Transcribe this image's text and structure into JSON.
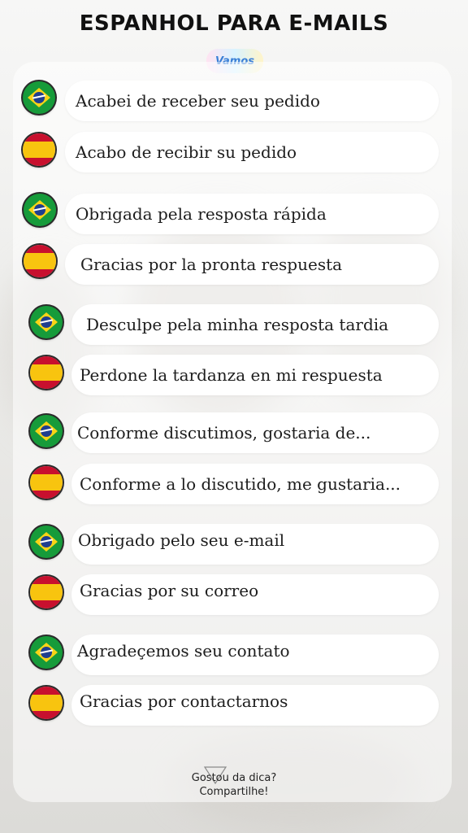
{
  "header": {
    "title": "ESPANHOL PARA E-MAILS",
    "logo_text": "Vamos"
  },
  "phrases": [
    {
      "lang": "pt",
      "flag": "brazil-flag-icon",
      "text": "Acabei de receber seu pedido"
    },
    {
      "lang": "es",
      "flag": "spain-flag-icon",
      "text": "Acabo de recibir su pedido"
    },
    {
      "lang": "pt",
      "flag": "brazil-flag-icon",
      "text": "Obrigada pela resposta rápida"
    },
    {
      "lang": "es",
      "flag": "spain-flag-icon",
      "text": "Gracias por la pronta respuesta"
    },
    {
      "lang": "pt",
      "flag": "brazil-flag-icon",
      "text": "Desculpe pela minha resposta tardia"
    },
    {
      "lang": "es",
      "flag": "spain-flag-icon",
      "text": "Perdone la tardanza en mi respuesta"
    },
    {
      "lang": "pt",
      "flag": "brazil-flag-icon",
      "text": "Conforme discutimos, gostaria de..."
    },
    {
      "lang": "es",
      "flag": "spain-flag-icon",
      "text": "Conforme a lo discutido, me gustaria..."
    },
    {
      "lang": "pt",
      "flag": "brazil-flag-icon",
      "text": "Obrigado pelo seu e-mail"
    },
    {
      "lang": "es",
      "flag": "spain-flag-icon",
      "text": "Gracias por su correo"
    },
    {
      "lang": "pt",
      "flag": "brazil-flag-icon",
      "text": "Agradeçemos seu contato"
    },
    {
      "lang": "es",
      "flag": "spain-flag-icon",
      "text": "Gracias por contactarnos"
    }
  ],
  "footer": {
    "line1": "Gostou da dica?",
    "line2": "Compartilhe!"
  },
  "colors": {
    "brazil_green": "#169b3a",
    "brazil_yellow": "#f7d417",
    "spain_red": "#c8102e",
    "spain_yellow": "#f8c40f"
  }
}
